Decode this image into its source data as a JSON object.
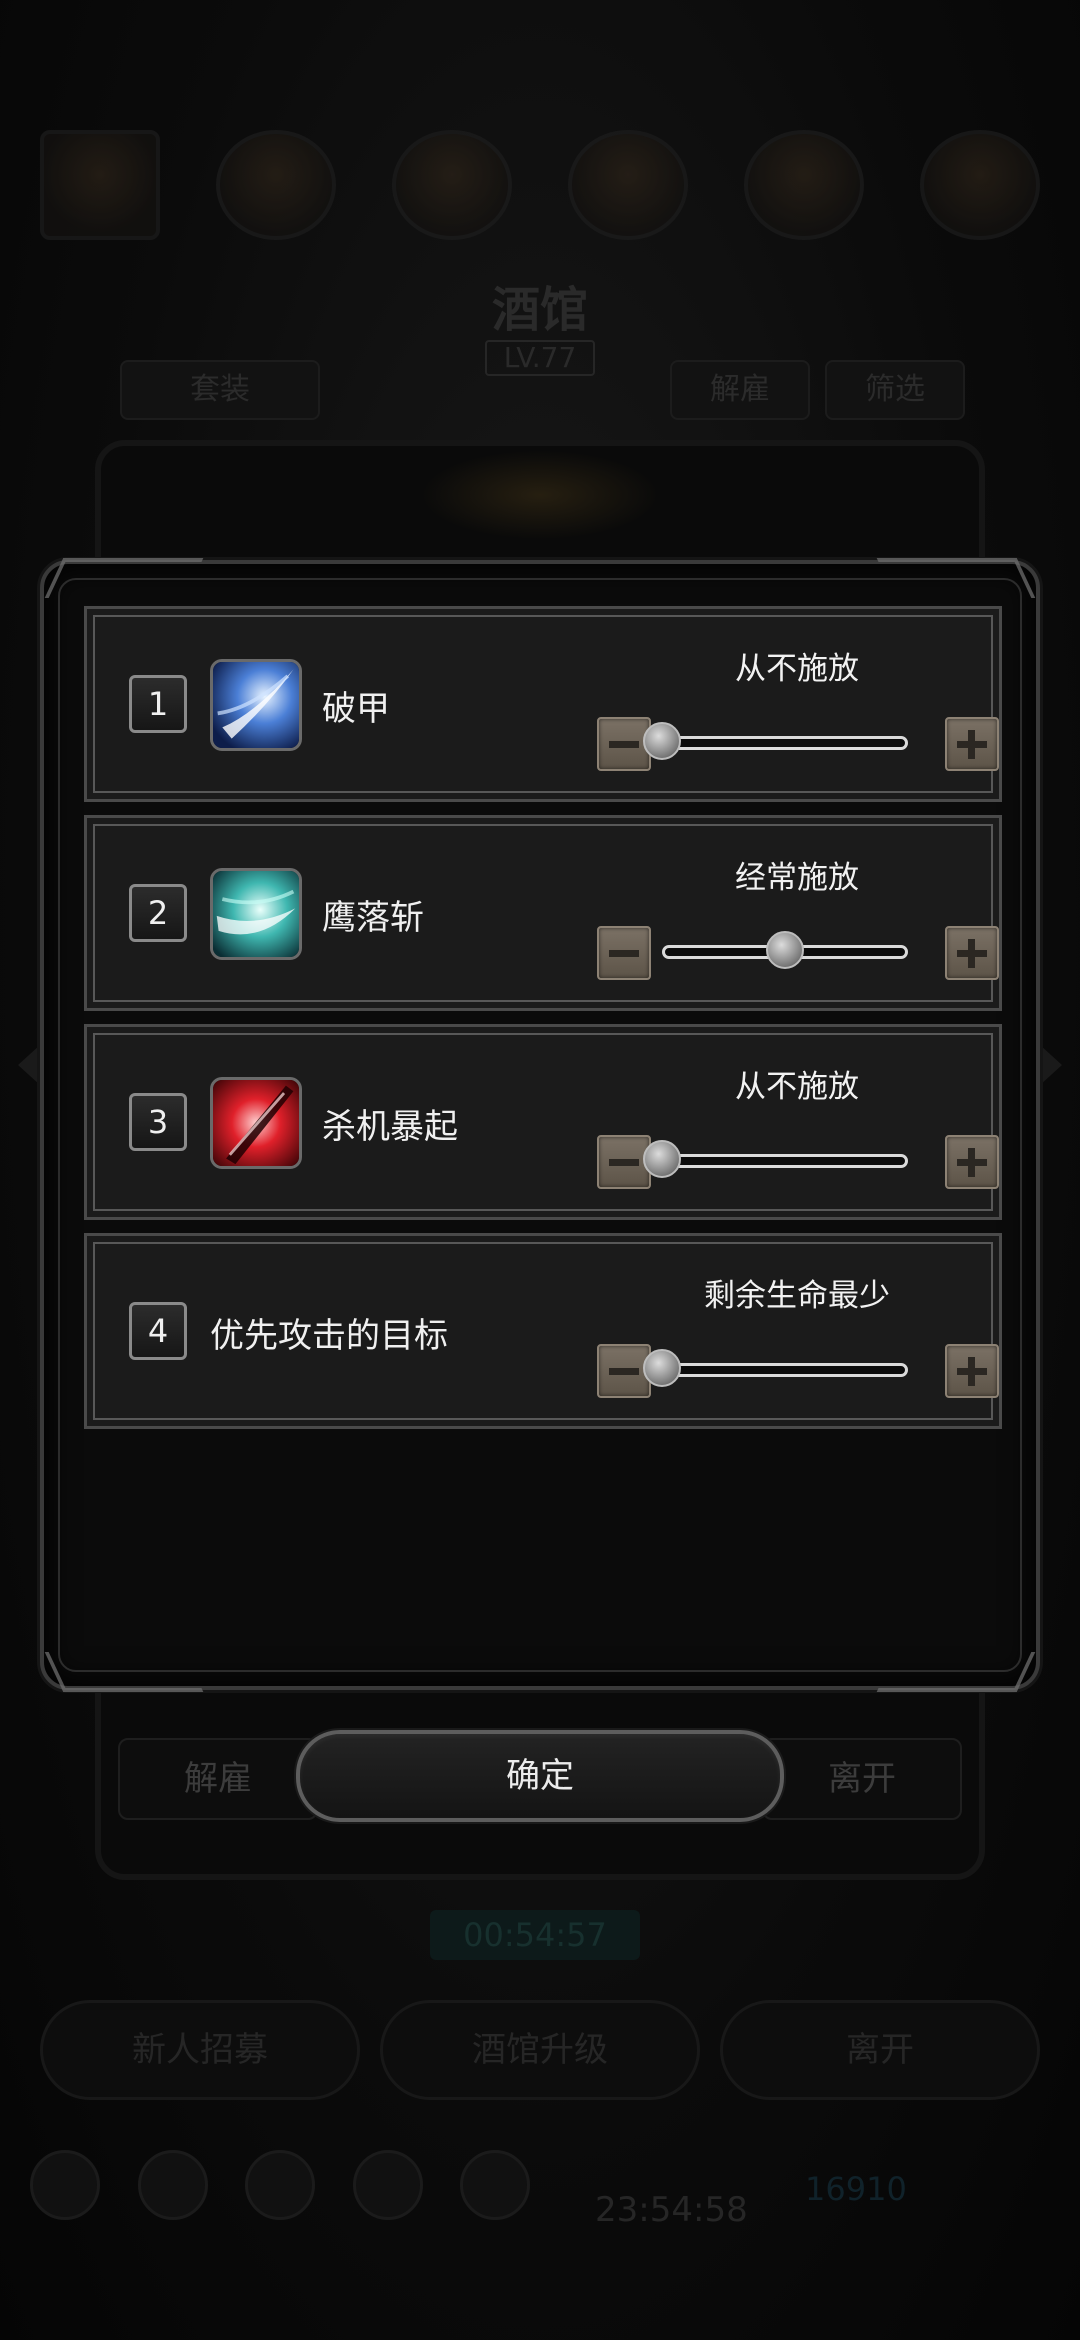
{
  "background": {
    "hero_name": "酒馆",
    "hero_level": "LV.77",
    "chips": [
      "套装",
      "解雇",
      "筛选"
    ],
    "timer": "00:54:57",
    "bottom_buttons": [
      "新人招募",
      "酒馆升级",
      "离开"
    ],
    "clock": "23:54:58",
    "gem_count": "16910"
  },
  "dialog": {
    "rows": [
      {
        "index": "1",
        "name": "破甲",
        "frequency": "从不施放",
        "level": 0.0,
        "icon": "blue-slash-skill-icon"
      },
      {
        "index": "2",
        "name": "鹰落斩",
        "frequency": "经常施放",
        "level": 0.5,
        "icon": "cyan-slash-skill-icon"
      },
      {
        "index": "3",
        "name": "杀机暴起",
        "frequency": "从不施放",
        "level": 0.0,
        "icon": "red-slash-skill-icon"
      },
      {
        "index": "4",
        "name": "优先攻击的目标",
        "frequency": "剩余生命最少",
        "level": 0.0,
        "icon": ""
      }
    ],
    "confirm_label": "确定",
    "dismiss_label": "解雇",
    "leave_label": "离开"
  },
  "colors": {
    "row_bg": "#1b1b1b",
    "stepper_button": "#6d6356",
    "text": "#f0f0f0"
  }
}
